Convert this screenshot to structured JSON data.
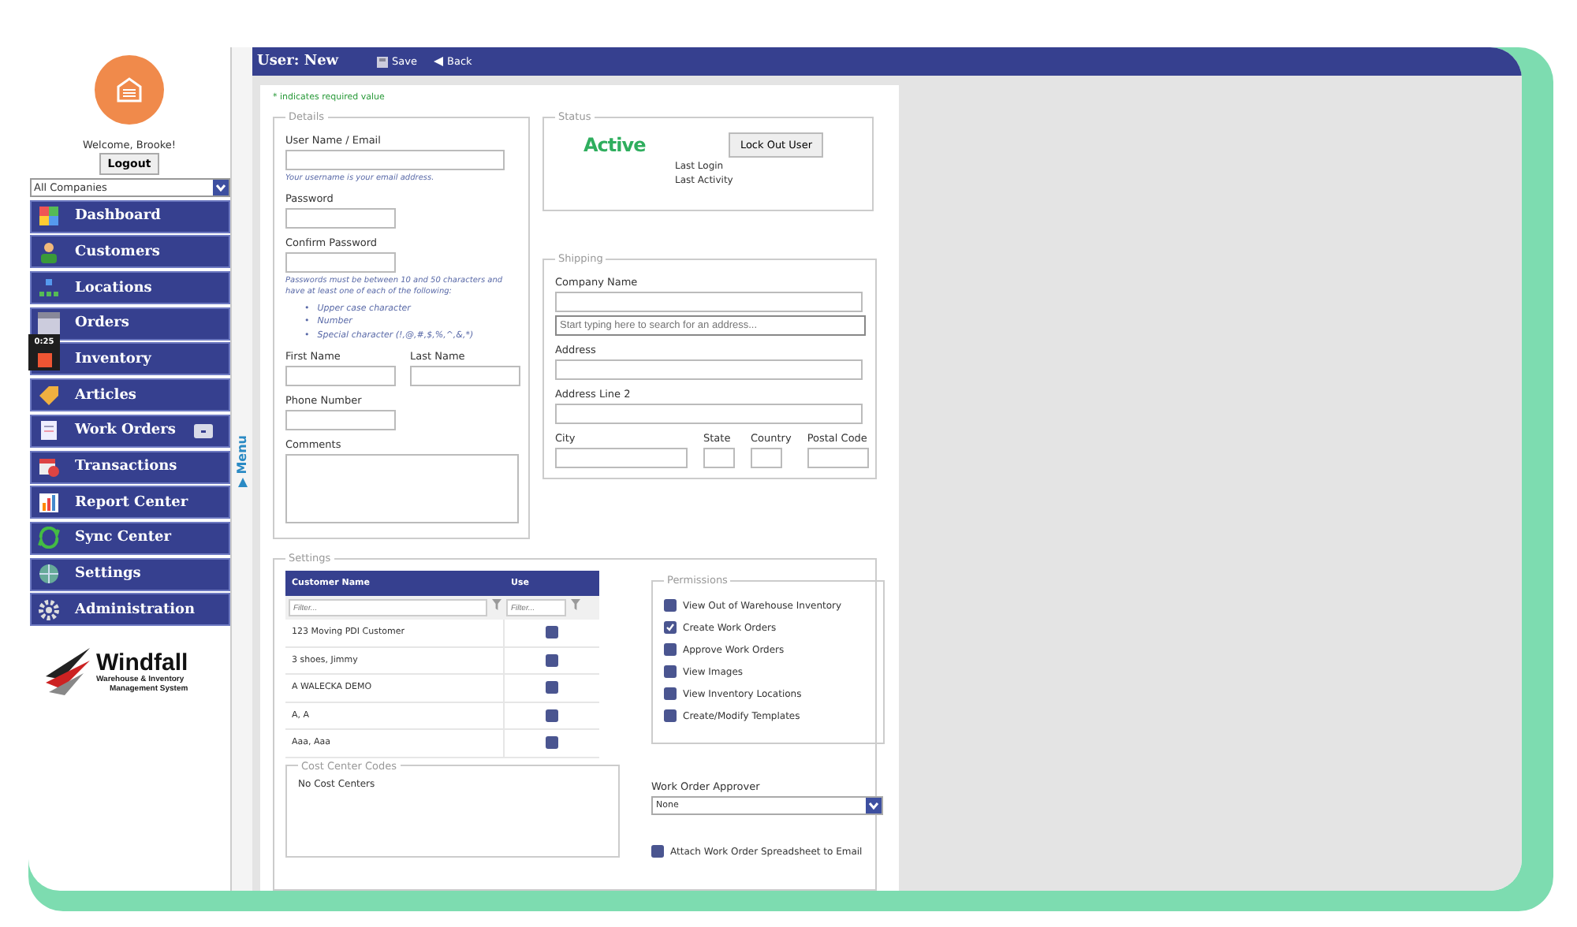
{
  "sidebar": {
    "welcome": "Welcome, Brooke!",
    "logout": "Logout",
    "company_select": "All Companies",
    "items": [
      {
        "label": "Dashboard",
        "badge": false
      },
      {
        "label": "Customers",
        "badge": false
      },
      {
        "label": "Locations",
        "badge": false
      },
      {
        "label": "Orders",
        "badge": false
      },
      {
        "label": "Inventory",
        "badge": false
      },
      {
        "label": "Articles",
        "badge": false
      },
      {
        "label": "Work Orders",
        "badge": true
      },
      {
        "label": "Transactions",
        "badge": false
      },
      {
        "label": "Report Center",
        "badge": false
      },
      {
        "label": "Sync Center",
        "badge": false
      },
      {
        "label": "Settings",
        "badge": false
      },
      {
        "label": "Administration",
        "badge": false
      }
    ],
    "logo": {
      "name": "Windfall",
      "tagline_1": "Warehouse & Inventory",
      "tagline_2": "Management System"
    }
  },
  "recorder": {
    "time": "0:25"
  },
  "menu_toggle": "Menu",
  "header": {
    "title": "User: New",
    "save": "Save",
    "back": "Back"
  },
  "required_note": "* indicates required value",
  "details": {
    "title": "Details",
    "username_label": "User Name / Email",
    "username_hint": "Your username is your email address.",
    "password_label": "Password",
    "confirm_label": "Confirm Password",
    "password_rules": "Passwords must be between 10 and 50 characters and have at least one of each of the following:",
    "rules": [
      {
        "bullet": "•",
        "text": "Upper case character"
      },
      {
        "bullet": "•",
        "text": "Number"
      },
      {
        "bullet": "•",
        "text": "Special character (!,@,#,$,%,^,&,*)"
      }
    ],
    "first_name_label": "First Name",
    "last_name_label": "Last Name",
    "phone_label": "Phone Number",
    "comments_label": "Comments"
  },
  "status": {
    "title": "Status",
    "value": "Active",
    "lock_button": "Lock Out User",
    "last_login": "Last Login",
    "last_activity": "Last Activity"
  },
  "shipping": {
    "title": "Shipping",
    "company_label": "Company Name",
    "address_search_placeholder": "Start typing here to search for an address...",
    "address_label": "Address",
    "address2_label": "Address Line 2",
    "city_label": "City",
    "state_label": "State",
    "country_label": "Country",
    "postal_label": "Postal Code"
  },
  "settings": {
    "title": "Settings",
    "table": {
      "columns": [
        "Customer Name",
        "Use"
      ],
      "filter_placeholders": [
        "Filter...",
        "Filter..."
      ],
      "rows": [
        {
          "name": "123 Moving PDI Customer",
          "use": false
        },
        {
          "name": "3 shoes, Jimmy",
          "use": false
        },
        {
          "name": "A WALECKA DEMO",
          "use": false
        },
        {
          "name": "A, A",
          "use": false
        },
        {
          "name": "Aaa, Aaa",
          "use": false
        }
      ]
    },
    "permissions": {
      "title": "Permissions",
      "items": [
        {
          "label": "View Out of Warehouse Inventory",
          "checked": false
        },
        {
          "label": "Create Work Orders",
          "checked": true
        },
        {
          "label": "Approve Work Orders",
          "checked": false
        },
        {
          "label": "View Images",
          "checked": false
        },
        {
          "label": "View Inventory Locations",
          "checked": false
        },
        {
          "label": "Create/Modify Templates",
          "checked": false
        }
      ]
    },
    "cost_centers": {
      "title": "Cost Center Codes",
      "empty": "No Cost Centers"
    },
    "approver": {
      "label": "Work Order Approver",
      "value": "None"
    },
    "attach": {
      "label": "Attach Work Order Spreadsheet to Email",
      "checked": false
    }
  }
}
